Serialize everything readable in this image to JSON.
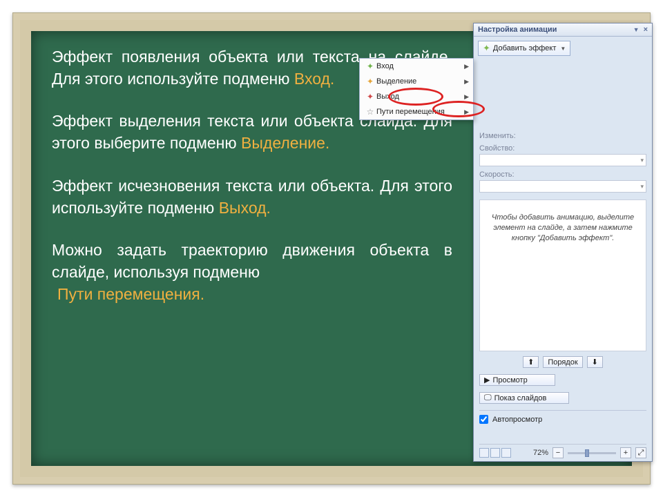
{
  "slide": {
    "p1a": "Эффект появления объекта или текста на слайде. Для этого используйте подменю ",
    "p1h": "Вход.",
    "p2a": "Эффект выделения текста или объекта слайда. Для этого выберите подменю ",
    "p2h": "Выделение.",
    "p3a": "Эффект исчезновения текста или объекта. Для этого используйте подменю ",
    "p3h": "Выход.",
    "p4a": "Можно задать траекторию движения объекта в слайде, используя подменю ",
    "p4h": "Пути перемещения."
  },
  "panel": {
    "title": "Настройка анимации",
    "addEffect": "Добавить эффект",
    "menu": {
      "enter": "Вход",
      "emphasis": "Выделение",
      "exit": "Выход",
      "motion": "Пути перемещения"
    },
    "field_change": "Изменить:",
    "field_prop": "Свойство:",
    "field_speed": "Скорость:",
    "hint": "Чтобы добавить анимацию, выделите элемент на слайде, а затем нажмите кнопку \"Добавить эффект\".",
    "order": "Порядок",
    "play": "Просмотр",
    "slideshow": "Показ слайдов",
    "autopreview": "Автопросмотр",
    "zoom": "72%"
  }
}
